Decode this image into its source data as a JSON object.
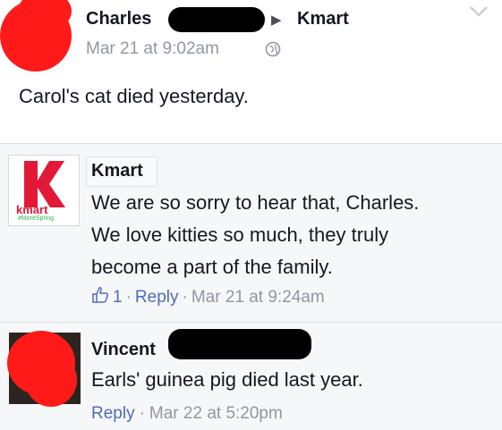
{
  "post": {
    "author": "Charles",
    "arrow": "▶",
    "target": "Kmart",
    "timestamp": "Mar 21 at 9:02am",
    "text": "Carol's cat died yesterday."
  },
  "comments": [
    {
      "author": "Kmart",
      "lines": [
        "We are so sorry to hear that, Charles.",
        "We love kitties so much, they truly",
        "become a part of the family."
      ],
      "like_count": "1",
      "reply_label": "Reply",
      "timestamp": "Mar 21 at 9:24am"
    },
    {
      "author": "Vincent",
      "text": "Earls' guinea pig died last year.",
      "reply_label": "Reply",
      "timestamp": "Mar 22 at 5:20pm"
    }
  ],
  "kmart_logo": {
    "letter": "K",
    "wordmark": "kmart",
    "tagline": "#MoreSpring"
  },
  "separator_dot": "·",
  "colors": {
    "brand_red": "#e31837",
    "link": "#4e6db8",
    "meta": "#9197a3",
    "redaction": "#ff1a1a"
  },
  "icons": [
    "globe-icon",
    "chevron-down-icon",
    "like-icon"
  ]
}
